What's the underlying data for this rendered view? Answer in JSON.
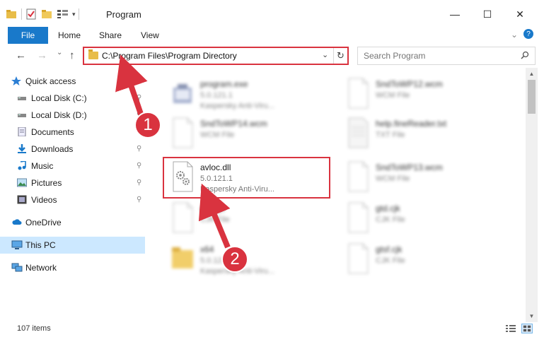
{
  "window": {
    "title": "Program",
    "minimize_glyph": "—",
    "maximize_glyph": "☐",
    "close_glyph": "✕"
  },
  "ribbon": {
    "file": "File",
    "home": "Home",
    "share": "Share",
    "view": "View",
    "expand_glyph": "⌄",
    "help_glyph": "?"
  },
  "nav": {
    "back_glyph": "←",
    "forward_glyph": "→",
    "recent_glyph": "⌄",
    "up_glyph": "↑"
  },
  "address": {
    "path": "C:\\Program Files\\Program Directory",
    "chevron_glyph": "⌄",
    "refresh_glyph": "↻"
  },
  "search": {
    "placeholder": "Search Program"
  },
  "sidebar": {
    "items": [
      {
        "label": "Quick access",
        "icon": "star-icon"
      },
      {
        "label": "Local Disk (C:)",
        "icon": "drive-icon"
      },
      {
        "label": "Local Disk (D:)",
        "icon": "drive-icon"
      },
      {
        "label": "Documents",
        "icon": "documents-icon"
      },
      {
        "label": "Downloads",
        "icon": "download-icon"
      },
      {
        "label": "Music",
        "icon": "music-icon"
      },
      {
        "label": "Pictures",
        "icon": "pictures-icon"
      },
      {
        "label": "Videos",
        "icon": "videos-icon"
      },
      {
        "label": "OneDrive",
        "icon": "cloud-icon"
      },
      {
        "label": "This PC",
        "icon": "computer-icon"
      },
      {
        "label": "Network",
        "icon": "network-icon"
      }
    ],
    "pin_glyph": "📌"
  },
  "files": [
    {
      "name": "program.exe",
      "meta1": "5.0.121.1",
      "meta2": "Kaspersky Anti-Viru...",
      "type": "exe"
    },
    {
      "name": "SndToWP12.wcm",
      "meta1": "WCM File",
      "meta2": "",
      "type": "doc"
    },
    {
      "name": "SndToWP14.wcm",
      "meta1": "WCM File",
      "meta2": "",
      "type": "doc"
    },
    {
      "name": "help.fineReader.txt",
      "meta1": "TXT File",
      "meta2": "",
      "type": "txt"
    },
    {
      "name": "avloc.dll",
      "meta1": "5.0.121.1",
      "meta2": "Kaspersky Anti-Viru...",
      "type": "dll"
    },
    {
      "name": "SndToWP13.wcm",
      "meta1": "WCM File",
      "meta2": "",
      "type": "doc"
    },
    {
      "name": "gtd.cjk",
      "meta1": "CJK File",
      "meta2": "",
      "type": "doc"
    },
    {
      "name": "gtd.cjk",
      "meta1": "CJK File",
      "meta2": "",
      "type": "doc"
    },
    {
      "name": "x64",
      "meta1": "5.0.121.1",
      "meta2": "Kaspersky Anti-Viru...",
      "type": "folder"
    },
    {
      "name": "gtsf.cjk",
      "meta1": "CJK File",
      "meta2": "",
      "type": "doc"
    }
  ],
  "status": {
    "count": "107 items"
  },
  "annotations": {
    "step1": "1",
    "step2": "2"
  },
  "colors": {
    "accent": "#1979ca",
    "annotation": "#d9333f",
    "selection": "#cce8ff"
  }
}
